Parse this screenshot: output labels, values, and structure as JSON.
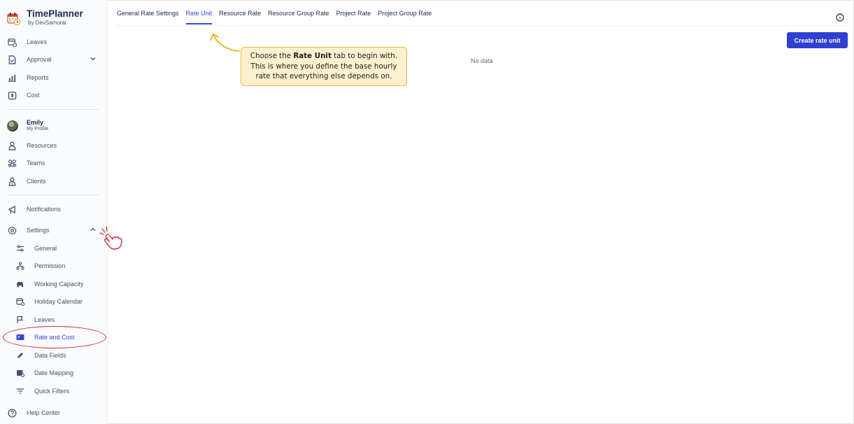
{
  "app": {
    "title": "TimePlanner",
    "subtitle": "by DevSamurai"
  },
  "sidebar": {
    "top_items": [
      {
        "label": "Leaves"
      },
      {
        "label": "Approval"
      },
      {
        "label": "Reports"
      },
      {
        "label": "Cost"
      }
    ],
    "profile": {
      "name": "Emily",
      "sub": "My Profile"
    },
    "people_items": [
      {
        "label": "Resources"
      },
      {
        "label": "Teams"
      },
      {
        "label": "Clients"
      }
    ],
    "notifications": "Notifications",
    "settings": "Settings",
    "settings_items": [
      {
        "label": "General"
      },
      {
        "label": "Permission"
      },
      {
        "label": "Working Capacity"
      },
      {
        "label": "Holiday Calendar"
      },
      {
        "label": "Leaves"
      },
      {
        "label": "Rate and Cost"
      },
      {
        "label": "Data Fields"
      },
      {
        "label": "Date Mapping"
      },
      {
        "label": "Quick Filters"
      }
    ],
    "help": "Help Center"
  },
  "tabs": [
    {
      "label": "General Rate Settings"
    },
    {
      "label": "Rate Unit"
    },
    {
      "label": "Resource Rate"
    },
    {
      "label": "Resource Group Rate"
    },
    {
      "label": "Project Rate"
    },
    {
      "label": "Project Group Rate"
    }
  ],
  "active_tab": "Rate Unit",
  "toolbar": {
    "create_label": "Create rate unit"
  },
  "content": {
    "empty_text": "No data"
  },
  "tooltip": {
    "line1_prefix": "Choose the ",
    "line1_bold": "Rate Unit",
    "line1_suffix": " tab to begin with.",
    "line2": "This is where you define the base hourly",
    "line3": "rate that everything else depends on."
  },
  "colors": {
    "accent": "#3040d0",
    "highlight": "#c92a3a",
    "tooltip_bg": "#fdf0cf"
  }
}
